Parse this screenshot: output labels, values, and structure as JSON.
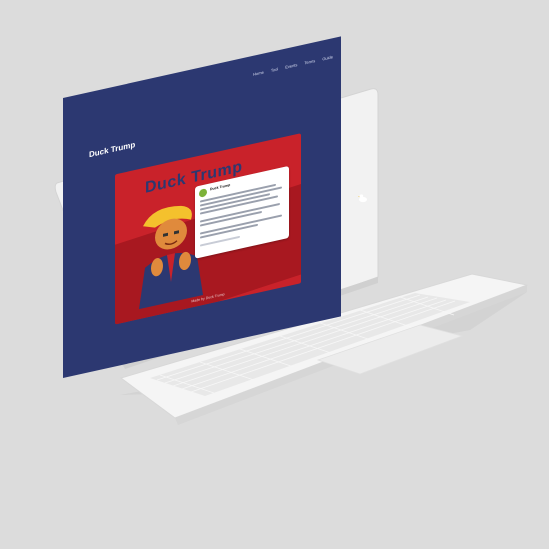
{
  "site": {
    "title": "Duck Trump",
    "nav": [
      "Home",
      "Tool",
      "Events",
      "Terms",
      "Guide"
    ]
  },
  "hero": {
    "title": "Duck Trump",
    "tweet": {
      "name": "Duck Trump"
    },
    "caption": "Made by Duck Trump"
  },
  "colors": {
    "background": "#dcdcdc",
    "site_bg": "#2c3871",
    "hero_red": "#c9222a",
    "laptop_body": "#f3f3f3"
  },
  "icons": [
    "duck-icon"
  ]
}
